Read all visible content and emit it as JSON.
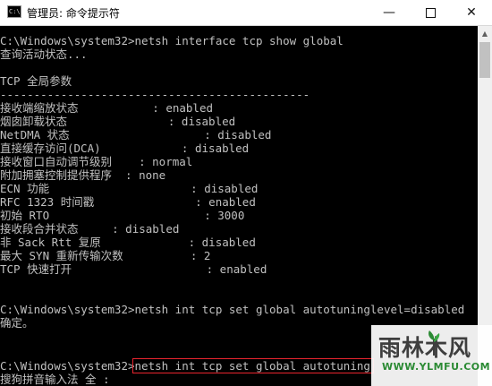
{
  "window": {
    "title": "管理员: 命令提示符",
    "icon": "cmd-icon",
    "controls": {
      "minimize": "—",
      "close": "✕"
    }
  },
  "console": {
    "lines": [
      "C:\\Windows\\system32>netsh interface tcp show global",
      "查询活动状态...",
      "",
      "TCP 全局参数",
      "----------------------------------------------",
      "接收端缩放状态           : enabled",
      "烟囱卸载状态               : disabled",
      "NetDMA 状态                    : disabled",
      "直接缓存访问(DCA)            : disabled",
      "接收窗口自动调节级别    : normal",
      "附加拥塞控制提供程序  : none",
      "ECN 功能                     : disabled",
      "RFC 1323 时间戳               : enabled",
      "初始 RTO                       : 3000",
      "接收段合并状态     : disabled",
      "非 Sack Rtt 复原             : disabled",
      "最大 SYN 重新传输次数          : 2",
      "TCP 快速打开                    : enabled",
      "",
      "",
      "C:\\Windows\\system32>netsh int tcp set global autotuninglevel=disabled",
      "确定。",
      "",
      "",
      "C:\\Windows\\system32>netsh int tcp set global autotuning",
      "搜狗拼音输入法 全 :"
    ]
  },
  "watermark": {
    "logo": "雨林木风",
    "url": "WWW.YLMFU.COM"
  },
  "colors": {
    "console_bg": "#000000",
    "console_text": "#c0c0c0",
    "highlight_border": "#e8242e",
    "watermark_green": "#2a8a33"
  }
}
